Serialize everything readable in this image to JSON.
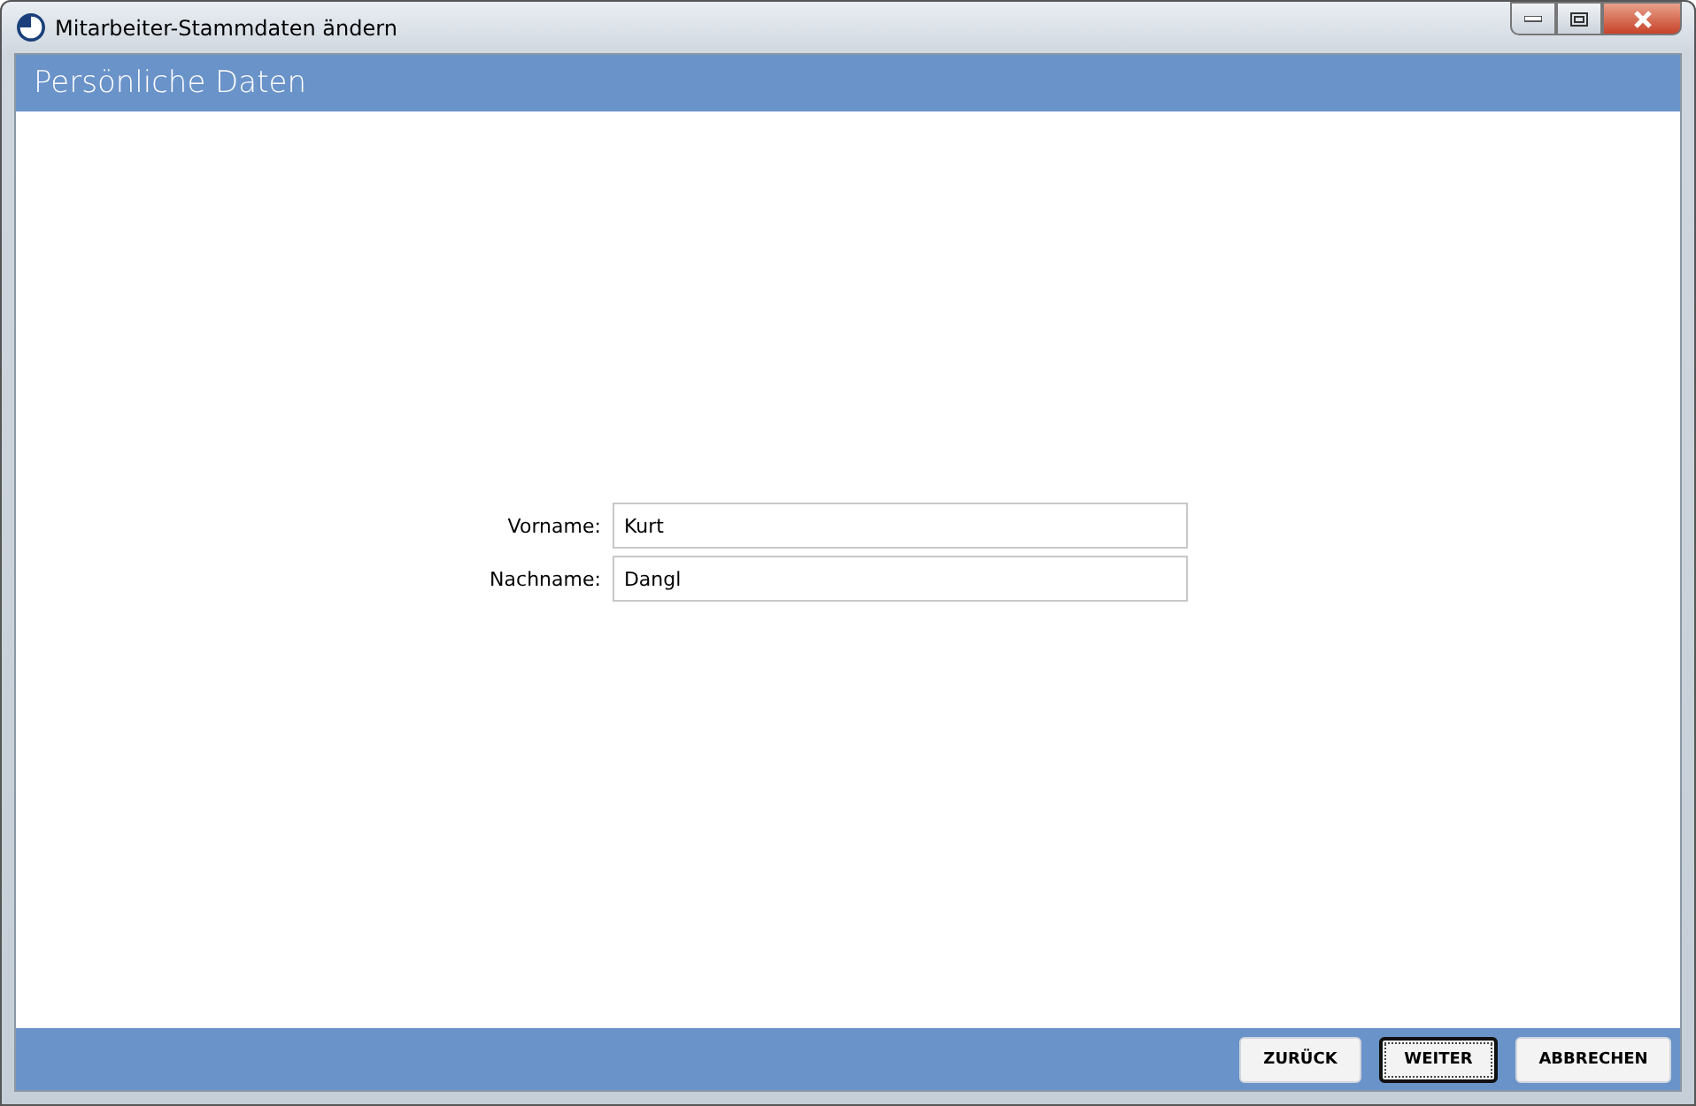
{
  "window": {
    "title": "Mitarbeiter-Stammdaten ändern"
  },
  "header": {
    "title": "Persönliche Daten"
  },
  "fields": [
    {
      "label": "Vorname:",
      "value": "Kurt"
    },
    {
      "label": "Nachname:",
      "value": "Dangl"
    }
  ],
  "buttons": [
    {
      "label": "ZURÜCK",
      "focused": false
    },
    {
      "label": "WEITER",
      "focused": true
    },
    {
      "label": "ABBRECHEN",
      "focused": false
    }
  ]
}
